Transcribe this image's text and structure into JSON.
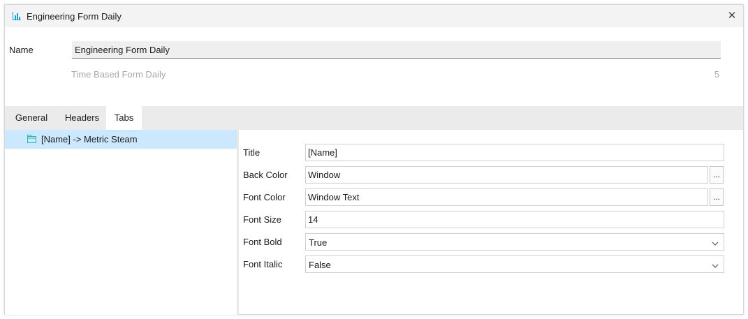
{
  "window": {
    "title": "Engineering Form Daily",
    "close_glyph": "✕",
    "icon": "bar-chart-icon"
  },
  "header": {
    "name_label": "Name",
    "name_value": "Engineering Form Daily",
    "sub_label": "Time Based Form Daily",
    "sub_count": "5"
  },
  "tabs": [
    {
      "label": "General",
      "active": false
    },
    {
      "label": "Headers",
      "active": false
    },
    {
      "label": "Tabs",
      "active": true
    }
  ],
  "tree": {
    "items": [
      {
        "label": "[Name] -> Metric Steam",
        "icon": "tab-folder-icon",
        "selected": true
      }
    ]
  },
  "properties": {
    "title": {
      "label": "Title",
      "value": "[Name]"
    },
    "back_color": {
      "label": "Back Color",
      "value": "Window",
      "button": "..."
    },
    "font_color": {
      "label": "Font Color",
      "value": "Window Text",
      "button": "..."
    },
    "font_size": {
      "label": "Font Size",
      "value": "14"
    },
    "font_bold": {
      "label": "Font Bold",
      "value": "True"
    },
    "font_italic": {
      "label": "Font Italic",
      "value": "False"
    }
  },
  "colors": {
    "selection": "#cce8ff",
    "icon_accent": "#1a9fd9",
    "tree_icon": "#2bb5a3"
  }
}
